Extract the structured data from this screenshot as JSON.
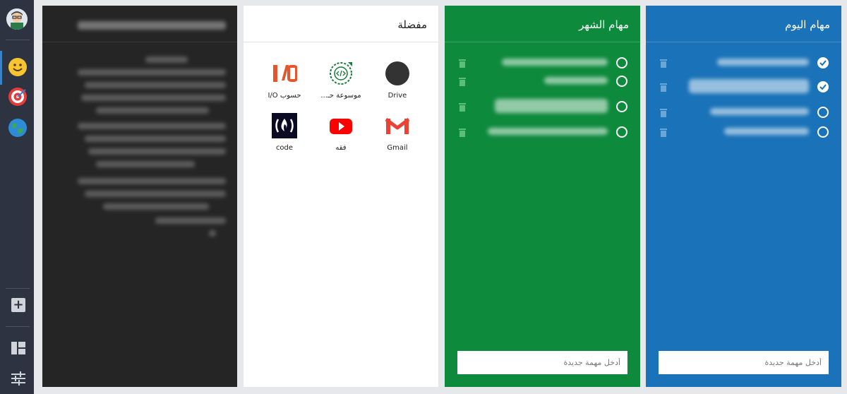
{
  "sidebar": {
    "avatar": "avatar",
    "icons": [
      "smile-emoji-icon",
      "target-icon",
      "globe-icon"
    ],
    "bottom_icons": [
      "add-icon",
      "layout-grid-icon",
      "settings-sliders-icon"
    ]
  },
  "favorites": {
    "title": "مفضلة",
    "items": [
      {
        "label": "Drive",
        "icon": "drive-circle-icon",
        "color": "#333333"
      },
      {
        "label": "موسوعة حـ...",
        "icon": "code-ring-icon",
        "color": "#1a7a3a"
      },
      {
        "label": "حسوب I/O",
        "icon": "io-logo-icon",
        "color": "#e4572e"
      },
      {
        "label": "Gmail",
        "icon": "gmail-icon",
        "color": "#ea4335"
      },
      {
        "label": "فقه",
        "icon": "youtube-icon",
        "color": "#ff0000"
      },
      {
        "label": "code",
        "icon": "freecodecamp-icon",
        "color": "#0a0a23"
      }
    ]
  },
  "month_tasks": {
    "title": "مهام الشهر",
    "input_placeholder": "أدخل مهمة جديدة",
    "color": "#0e8a3c"
  },
  "today_tasks": {
    "title": "مهام اليوم",
    "input_placeholder": "أدخل مهمة جديدة",
    "color": "#1a73b8"
  }
}
